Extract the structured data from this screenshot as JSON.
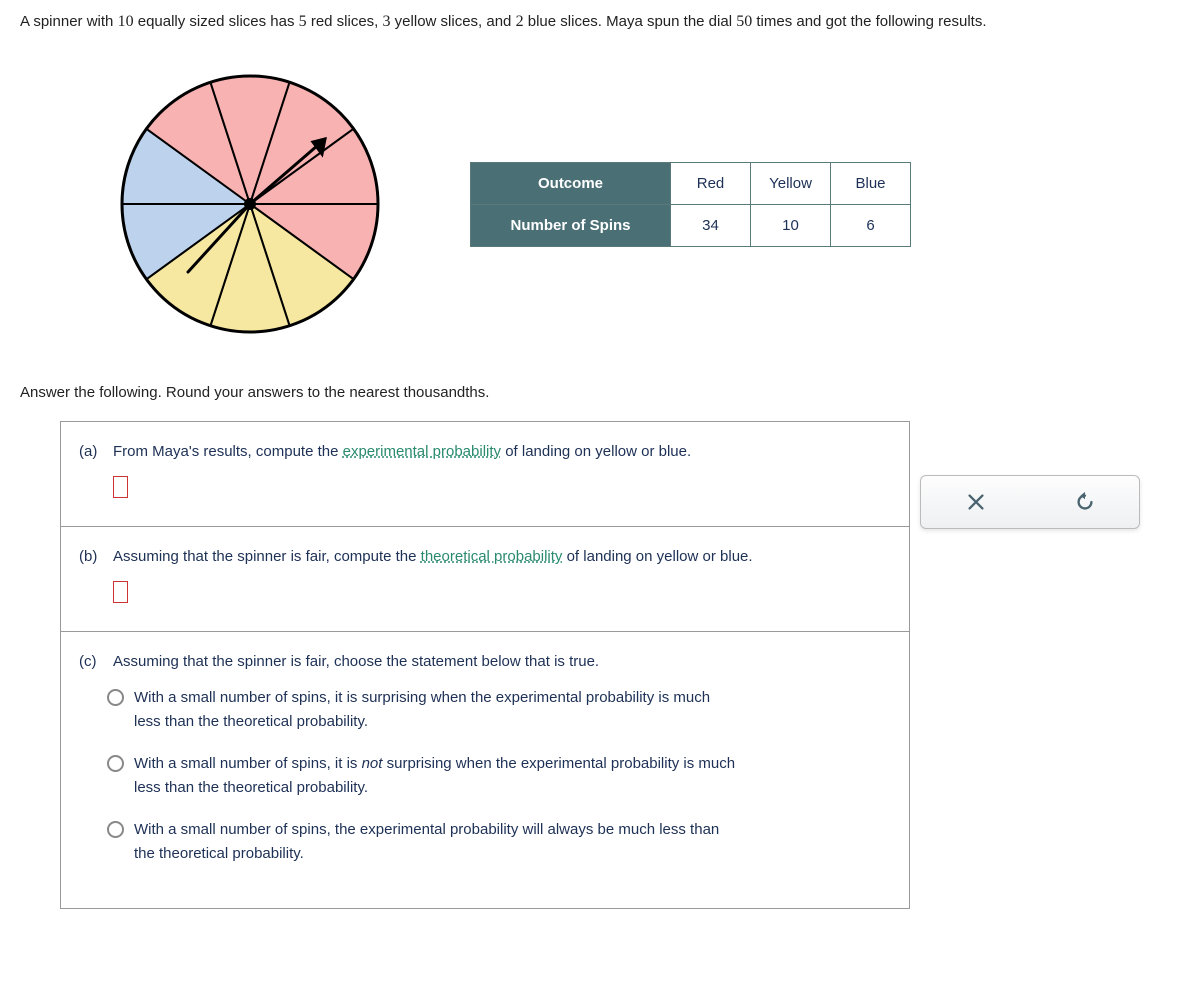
{
  "problem": {
    "text_parts": [
      "A spinner with ",
      "10",
      " equally sized slices has ",
      "5",
      " red slices, ",
      "3",
      " yellow slices, and ",
      "2",
      " blue slices. Maya spun the dial ",
      "50",
      " times and got the following results."
    ]
  },
  "spinner": {
    "colors": {
      "red": "#f9b2b2",
      "yellow": "#f6e8a0",
      "blue": "#bdd3ed"
    },
    "slices": [
      "blue",
      "red",
      "red",
      "red",
      "red",
      "red",
      "yellow",
      "yellow",
      "yellow",
      "blue"
    ]
  },
  "table": {
    "row1_header": "Outcome",
    "row1_cells": [
      "Red",
      "Yellow",
      "Blue"
    ],
    "row2_header": "Number of Spins",
    "row2_cells": [
      "34",
      "10",
      "6"
    ]
  },
  "instruction": "Answer the following. Round your answers to the nearest thousandths.",
  "parts": {
    "a": {
      "letter": "(a)",
      "before_link": "From Maya's results, compute the ",
      "link": "experimental probability",
      "after_link": " of landing on yellow or blue."
    },
    "b": {
      "letter": "(b)",
      "before_link": "Assuming that the spinner is fair, compute the ",
      "link": "theoretical probability",
      "after_link": " of landing on yellow or blue."
    },
    "c": {
      "letter": "(c)",
      "prompt": "Assuming that the spinner is fair, choose the statement below that is true.",
      "options": [
        {
          "l1": "With a small number of spins, it is surprising when the experimental probability is much",
          "l2": "less than the theoretical probability."
        },
        {
          "l1_pre": "With a small number of spins, it is ",
          "l1_em": "not",
          "l1_post": " surprising when the experimental probability is much",
          "l2": "less than the theoretical probability."
        },
        {
          "l1": "With a small number of spins, the experimental probability will always be much less than",
          "l2": "the theoretical probability."
        }
      ]
    }
  },
  "chart_data": {
    "type": "table",
    "title": "Spinner results",
    "categories": [
      "Red",
      "Yellow",
      "Blue"
    ],
    "values": [
      34,
      10,
      6
    ],
    "total_spins": 50,
    "spinner_composition": {
      "red": 5,
      "yellow": 3,
      "blue": 2,
      "total_slices": 10
    }
  }
}
